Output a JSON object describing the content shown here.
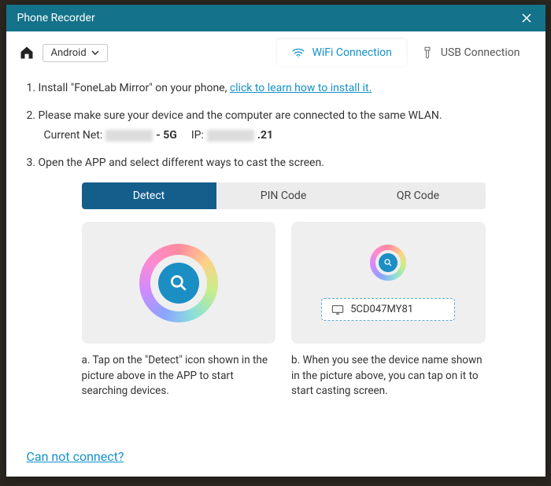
{
  "titlebar": {
    "title": "Phone Recorder"
  },
  "toolbar": {
    "platform_selected": "Android",
    "conn_tabs": {
      "wifi": "WiFi Connection",
      "usb": "USB Connection"
    }
  },
  "steps": {
    "s1_prefix": "1. Install \"FoneLab Mirror\" on your phone, ",
    "s1_link": "click to learn how to install it.",
    "s2": "2. Please make sure your device and the computer are connected to the same WLAN.",
    "net_label": "Current Net:",
    "net_suffix": "- 5G",
    "ip_label": "IP:",
    "ip_suffix": ".21",
    "s3": "3. Open the APP and select different ways to cast the screen."
  },
  "modes": {
    "detect": "Detect",
    "pin": "PIN Code",
    "qr": "QR Code"
  },
  "device": {
    "name": "5CD047MY81"
  },
  "captions": {
    "a": "a. Tap on the \"Detect\" icon shown in the picture above in the APP to start searching devices.",
    "b": "b. When you see the device name shown in the picture above, you can tap on it to start casting screen."
  },
  "footer": {
    "help_link": "Can not connect?"
  }
}
